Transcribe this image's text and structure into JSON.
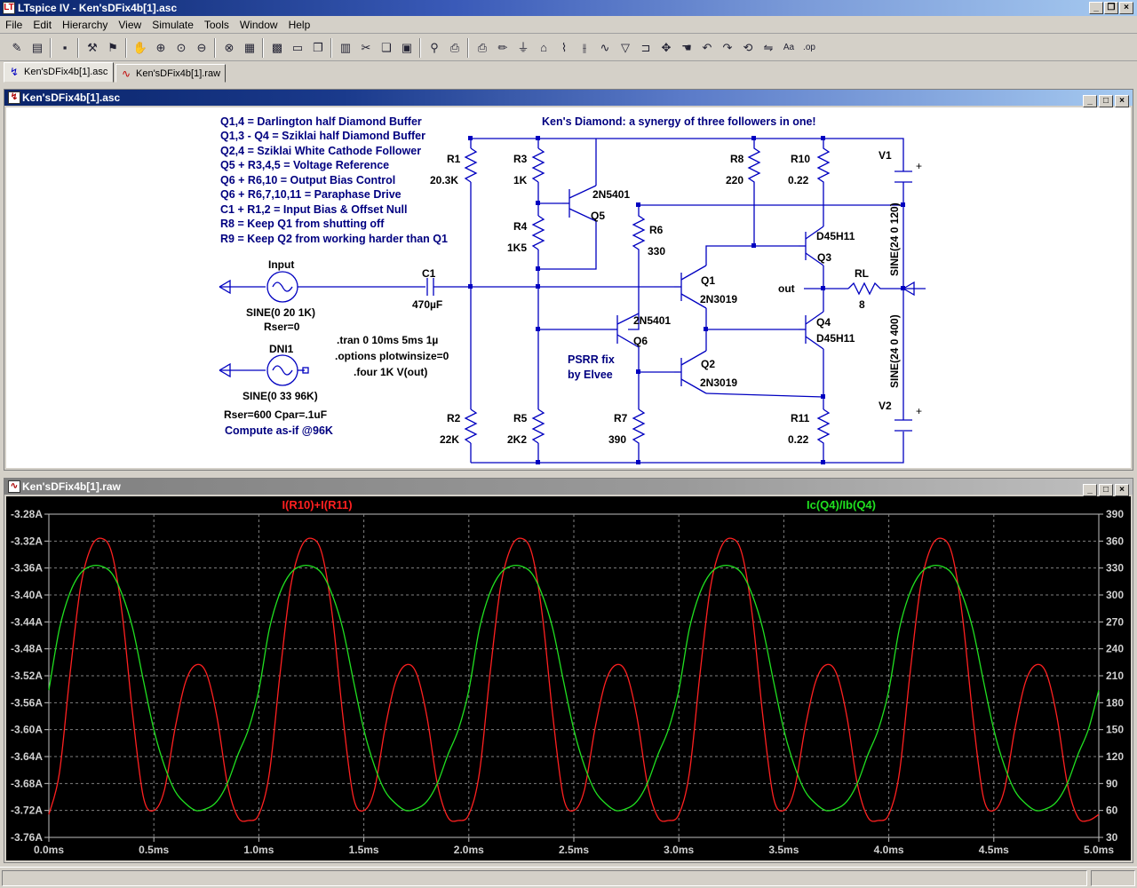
{
  "app": {
    "title": "LTspice IV - Ken'sDFix4b[1].asc",
    "icon_label": "LT"
  },
  "menu": [
    "File",
    "Edit",
    "Hierarchy",
    "View",
    "Simulate",
    "Tools",
    "Window",
    "Help"
  ],
  "toolbar": {
    "buttons": [
      {
        "name": "new-schematic",
        "glyph": "✎"
      },
      {
        "name": "open",
        "glyph": "▤"
      },
      {
        "name": "save",
        "glyph": "▪"
      },
      {
        "name": "control-panel",
        "glyph": "⚒"
      },
      {
        "name": "run",
        "glyph": "⚑"
      },
      {
        "name": "halt",
        "glyph": "✋"
      },
      {
        "name": "zoom-in",
        "glyph": "⊕"
      },
      {
        "name": "pan",
        "glyph": "⊙"
      },
      {
        "name": "zoom-out",
        "glyph": "⊖"
      },
      {
        "name": "zoom-fit",
        "glyph": "⊗"
      },
      {
        "name": "autorange",
        "glyph": "▦"
      },
      {
        "name": "grid",
        "glyph": "▩"
      },
      {
        "name": "tile-horizontal",
        "glyph": "▭"
      },
      {
        "name": "cascade",
        "glyph": "❐"
      },
      {
        "name": "tile-vertical",
        "glyph": "▥"
      },
      {
        "name": "cut",
        "glyph": "✂"
      },
      {
        "name": "copy",
        "glyph": "❏"
      },
      {
        "name": "paste",
        "glyph": "▣"
      },
      {
        "name": "find",
        "glyph": "⚲"
      },
      {
        "name": "print-preview",
        "glyph": "⎙"
      },
      {
        "name": "print",
        "glyph": "⎙"
      },
      {
        "name": "draw-wire",
        "glyph": "✏"
      },
      {
        "name": "ground",
        "glyph": "⏚"
      },
      {
        "name": "label-net",
        "glyph": "⌂"
      },
      {
        "name": "resistor",
        "glyph": "⌇"
      },
      {
        "name": "capacitor",
        "glyph": "⫲"
      },
      {
        "name": "inductor",
        "glyph": "∿"
      },
      {
        "name": "diode",
        "glyph": "▽"
      },
      {
        "name": "component",
        "glyph": "⊐"
      },
      {
        "name": "move",
        "glyph": "✥"
      },
      {
        "name": "drag",
        "glyph": "☚"
      },
      {
        "name": "undo",
        "glyph": "↶"
      },
      {
        "name": "redo",
        "glyph": "↷"
      },
      {
        "name": "rotate",
        "glyph": "⟲"
      },
      {
        "name": "mirror",
        "glyph": "⇋"
      },
      {
        "name": "text",
        "glyph": "Aa"
      },
      {
        "name": "spice-directive",
        "glyph": ".op"
      }
    ]
  },
  "tabs": [
    {
      "label": "Ken'sDFix4b[1].asc",
      "icon": "schematic-icon"
    },
    {
      "label": "Ken'sDFix4b[1].raw",
      "icon": "waveform-icon"
    }
  ],
  "schematic_window": {
    "title": "Ken'sDFix4b[1].asc",
    "notes": [
      "Q1,4 = Darlington half Diamond Buffer",
      "Q1,3 - Q4 = Sziklai half Diamond Buffer",
      "Q2,4 = Sziklai White Cathode Follower",
      "Q5 + R3,4,5 = Voltage Reference",
      "Q6 + R6,10 = Output Bias Control",
      "Q6 + R6,7,10,11 = Paraphase Drive",
      "C1 + R1,2 = Input Bias & Offset Null",
      "R8 = Keep Q1 from shutting off",
      "R9 = Keep Q2 from working harder than Q1"
    ],
    "heading": "Ken's Diamond: a synergy of three followers in one!",
    "directives": [
      ".tran 0 10ms 5ms 1µ",
      ".options plotwinsize=0",
      ".four 1K V(out)"
    ],
    "psrr": [
      "PSRR fix",
      "by Elvee"
    ],
    "compute_note": "Compute as-if @96K",
    "sources": {
      "input": {
        "name": "Input",
        "value": "SINE(0 20 1K)",
        "extra": "Rser=0"
      },
      "dni1": {
        "name": "DNI1",
        "value": "SINE(0 33 96K)",
        "extra": "Rser=600 Cpar=.1uF"
      },
      "v1": {
        "name": "V1",
        "value": "SINE(24 0 120)"
      },
      "v2": {
        "name": "V2",
        "value": "SINE(24 0 400)"
      }
    },
    "components": {
      "c1": {
        "name": "C1",
        "value": "470µF"
      },
      "r1": {
        "name": "R1",
        "value": "20.3K"
      },
      "r2": {
        "name": "R2",
        "value": "22K"
      },
      "r3": {
        "name": "R3",
        "value": "1K"
      },
      "r4": {
        "name": "R4",
        "value": "1K5"
      },
      "r5": {
        "name": "R5",
        "value": "2K2"
      },
      "r6": {
        "name": "R6",
        "value": "330"
      },
      "r7": {
        "name": "R7",
        "value": "390"
      },
      "r8": {
        "name": "R8",
        "value": "220"
      },
      "r10": {
        "name": "R10",
        "value": "0.22"
      },
      "r11": {
        "name": "R11",
        "value": "0.22"
      },
      "rl": {
        "name": "RL",
        "value": "8"
      },
      "q1": {
        "name": "Q1",
        "model": "2N3019"
      },
      "q2": {
        "name": "Q2",
        "model": "2N3019"
      },
      "q3": {
        "name": "Q3",
        "model": "D45H11"
      },
      "q4": {
        "name": "Q4",
        "model": "D45H11"
      },
      "q5": {
        "name": "Q5",
        "model": "2N5401"
      },
      "q6": {
        "name": "Q6",
        "model": "2N5401"
      }
    },
    "net_out": "out"
  },
  "plot_window": {
    "title": "Ken'sDFix4b[1].raw"
  },
  "chart_data": {
    "type": "line",
    "title": "",
    "x": {
      "label": "",
      "min": 0.0,
      "max": 5.0,
      "unit": "ms",
      "ticks": [
        "0.0ms",
        "0.5ms",
        "1.0ms",
        "1.5ms",
        "2.0ms",
        "2.5ms",
        "3.0ms",
        "3.5ms",
        "4.0ms",
        "4.5ms",
        "5.0ms"
      ]
    },
    "y_left": {
      "min": -3.76,
      "max": -3.28,
      "ticks": [
        "-3.28A",
        "-3.32A",
        "-3.36A",
        "-3.40A",
        "-3.44A",
        "-3.48A",
        "-3.52A",
        "-3.56A",
        "-3.60A",
        "-3.64A",
        "-3.68A",
        "-3.72A",
        "-3.76A"
      ]
    },
    "y_right": {
      "min": 30,
      "max": 390,
      "ticks": [
        "390",
        "360",
        "330",
        "300",
        "270",
        "240",
        "210",
        "180",
        "150",
        "120",
        "90",
        "60",
        "30"
      ]
    },
    "grid": true,
    "background": "#000000",
    "series": [
      {
        "name": "I(R10)+I(R11)",
        "axis": "left",
        "color": "#ff2020",
        "x": [
          0.0,
          0.05,
          0.1,
          0.15,
          0.2,
          0.25,
          0.3,
          0.35,
          0.4,
          0.45,
          0.5,
          0.55,
          0.6,
          0.65,
          0.7,
          0.75,
          0.8,
          0.85,
          0.9,
          0.95,
          1.0
        ],
        "y": [
          -3.726,
          -3.665,
          -3.52,
          -3.39,
          -3.33,
          -3.316,
          -3.338,
          -3.43,
          -3.58,
          -3.7,
          -3.72,
          -3.69,
          -3.6,
          -3.53,
          -3.504,
          -3.516,
          -3.58,
          -3.68,
          -3.73,
          -3.735,
          -3.726
        ],
        "period_ms": 1.0
      },
      {
        "name": "Ic(Q4)/Ib(Q4)",
        "axis": "right",
        "color": "#20e020",
        "x": [
          0.0,
          0.05,
          0.1,
          0.15,
          0.2,
          0.25,
          0.3,
          0.35,
          0.4,
          0.45,
          0.5,
          0.55,
          0.6,
          0.65,
          0.7,
          0.75,
          0.8,
          0.85,
          0.9,
          0.95,
          1.0
        ],
        "y": [
          194,
          262,
          302,
          324,
          332,
          332,
          324,
          300,
          262,
          205,
          150,
          110,
          82,
          68,
          60,
          62,
          70,
          90,
          122,
          150,
          194
        ],
        "period_ms": 1.0
      }
    ]
  },
  "colors": {
    "schematic_wire": "#0000c0",
    "schematic_text": "#000080",
    "active_title": "#0a246a",
    "trace_red": "#ff2020",
    "trace_green": "#20e020"
  }
}
